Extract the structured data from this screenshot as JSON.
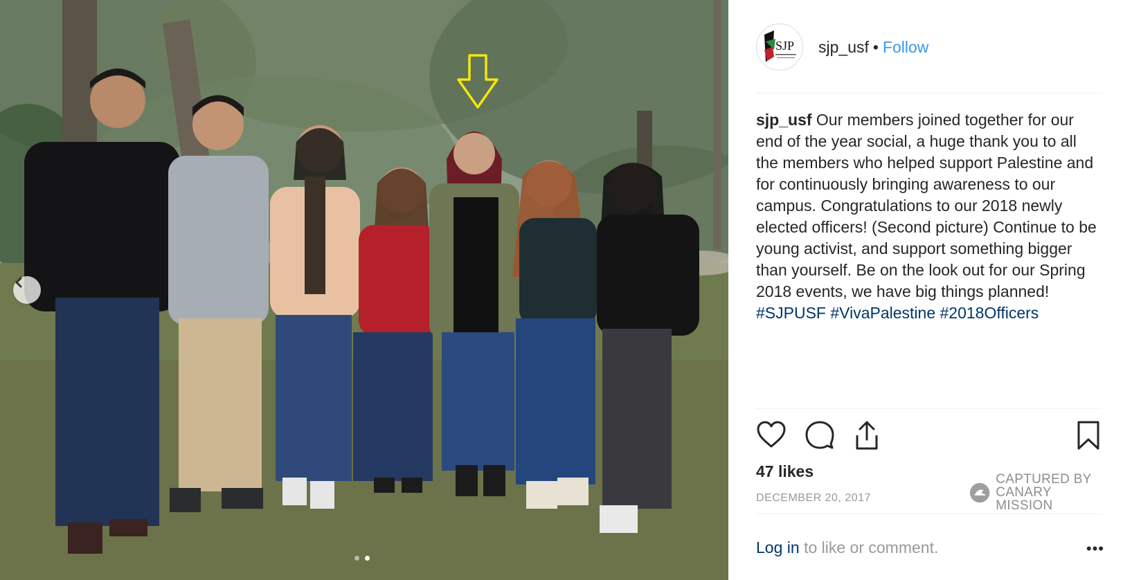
{
  "post": {
    "username": "sjp_usf",
    "separator": "•",
    "follow_label": "Follow",
    "avatar_text": "SJP",
    "caption": {
      "username": "sjp_usf",
      "text": "Our members joined together for our end of the year social, a huge thank you to all the members who helped support Palestine and for continuously bringing awareness to our campus. Congratulations to our 2018 newly elected officers! (Second picture) Continue to be young activist, and support something bigger than yourself. Be on the look out for our Spring 2018 events, we have big things planned!",
      "hashtags": [
        "#SJPUSF",
        "#VivaPalestine",
        "#2018Officers"
      ]
    },
    "likes": "47 likes",
    "date": "DECEMBER 20, 2017",
    "login_link": "Log in",
    "login_rest": "to like or comment.",
    "more_label": "•••"
  },
  "watermark": {
    "line1": "CAPTURED BY",
    "line2": "CANARY MISSION"
  },
  "carousel": {
    "total_slides": 2,
    "active_slide": 2
  },
  "icons": {
    "prev": "chevron-left-icon",
    "like": "heart-icon",
    "comment": "comment-icon",
    "share": "share-icon",
    "save": "bookmark-icon",
    "annotation": "down-arrow-icon"
  },
  "colors": {
    "link": "#3897f0",
    "hashtag": "#003569",
    "muted": "#999999",
    "arrow": "#f5e611"
  }
}
